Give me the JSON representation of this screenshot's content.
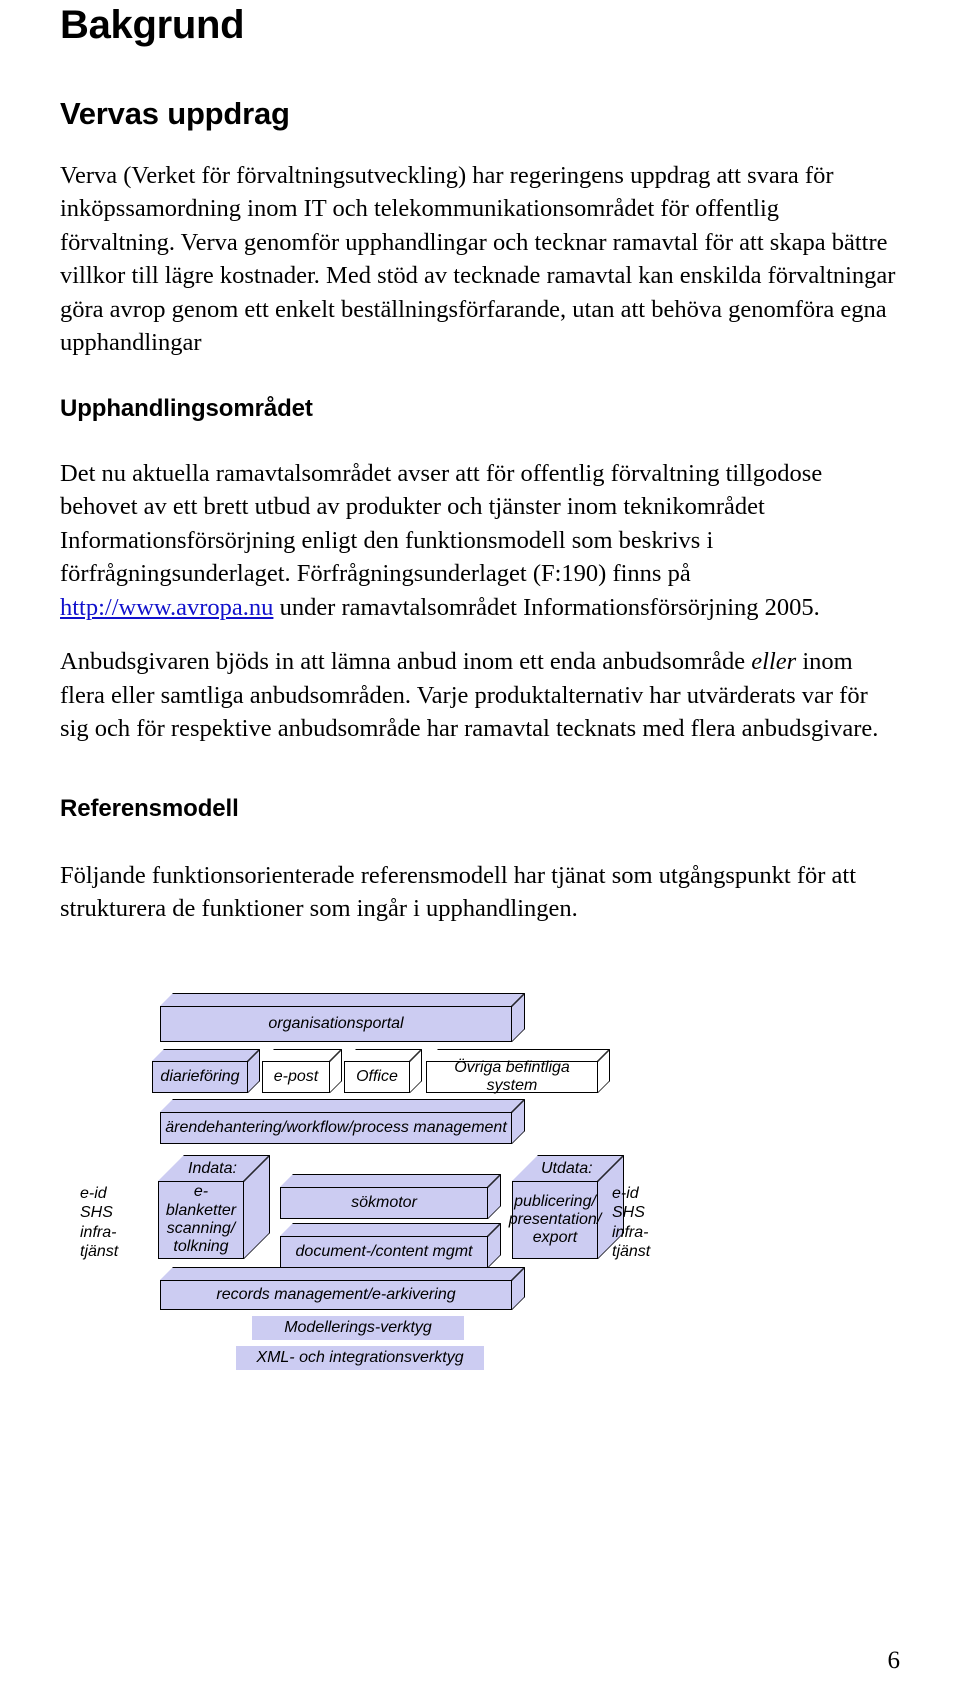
{
  "document": {
    "page_number": "6",
    "link_color": "#1111cc",
    "diagram_fill": "#ccccf2"
  },
  "headings": {
    "h1": "Bakgrund",
    "uppdrag": "Vervas uppdrag",
    "upphandling": "Upphandlingsområdet",
    "referensmodell": "Referensmodell"
  },
  "paragraphs": {
    "uppdrag_p1": "Verva (Verket för förvaltningsutveckling) har regeringens uppdrag att svara för inköpssamordning inom IT och telekommunikationsområdet för offentlig förvaltning. Verva genomför upphandlingar och tecknar ramavtal för att skapa bättre villkor till lägre kostnader. Med stöd av tecknade ramavtal kan enskilda förvaltningar göra avrop genom ett enkelt beställningsförfarande, utan att behöva genomföra egna upphandlingar",
    "upph_p1_before_link": "Det nu aktuella ramavtalsområdet avser att för offentlig förvaltning tillgodose behovet av ett brett utbud av produkter och tjänster inom teknikområdet Informationsförsörjning enligt den funktionsmodell som beskrivs i förfrågningsunderlaget. Förfrågningsunderlaget (F:190) finns på ",
    "upph_p1_link": "http://www.avropa.nu",
    "upph_p1_after_link": " under ramavtalsområdet Informationsförsörjning 2005.",
    "upph_p2_a": "Anbudsgivaren bjöds in att lämna anbud inom ett enda anbudsområde ",
    "upph_p2_italic": "eller",
    "upph_p2_b": " inom flera eller samtliga anbudsområden. Varje produktalternativ har utvärderats var för sig och för respektive anbudsområde har ramavtal tecknats med flera anbudsgivare.",
    "ref_p1": "Följande funktionsorienterade referensmodell har tjänat som utgångspunkt för att strukturera de funktioner som ingår i upphandlingen."
  },
  "diagram": {
    "organisationsportal": "organisationsportal",
    "diariefoering": "diarieföring",
    "epost": "e-post",
    "office": "Office",
    "ovriga": "Övriga befintliga system",
    "arendehantering": "ärendehantering/workflow/process management",
    "indata_title": "Indata:",
    "indata_body": "e-blanketter\nscanning/\ntolkning",
    "sokmotor": "sökmotor",
    "docmgmt": "document-/content mgmt",
    "utdata_title": "Utdata:",
    "utdata_body": "publicering/\npresentation/\nexport",
    "records": "records management/e-arkivering",
    "modellering": "Modellerings-verktyg",
    "xml": "XML- och integrationsverktyg",
    "left_caption": "e-id\nSHS\ninfra-\ntjänst",
    "right_caption": "e-id\nSHS\ninfra-\ntjänst"
  }
}
